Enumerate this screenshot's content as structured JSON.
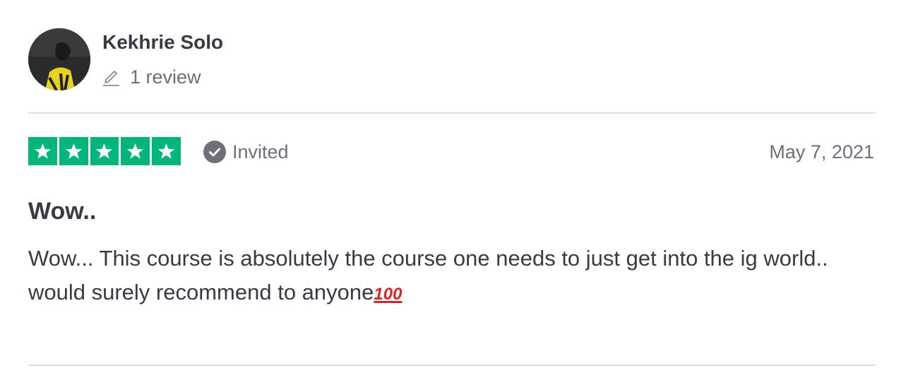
{
  "reviewer": {
    "name": "Kekhrie Solo",
    "review_count_label": "1 review",
    "avatar_icon": "reviewer-photo"
  },
  "review": {
    "rating": 5,
    "rating_max": 5,
    "star_color": "#00b67a",
    "badge_label": "Invited",
    "date": "May 7, 2021",
    "title": "Wow..",
    "body_lines": [
      "Wow... This course is absolutely the course one needs to just get into the ig world..",
      "would surely recommend to anyone"
    ],
    "emoji": "💯"
  }
}
